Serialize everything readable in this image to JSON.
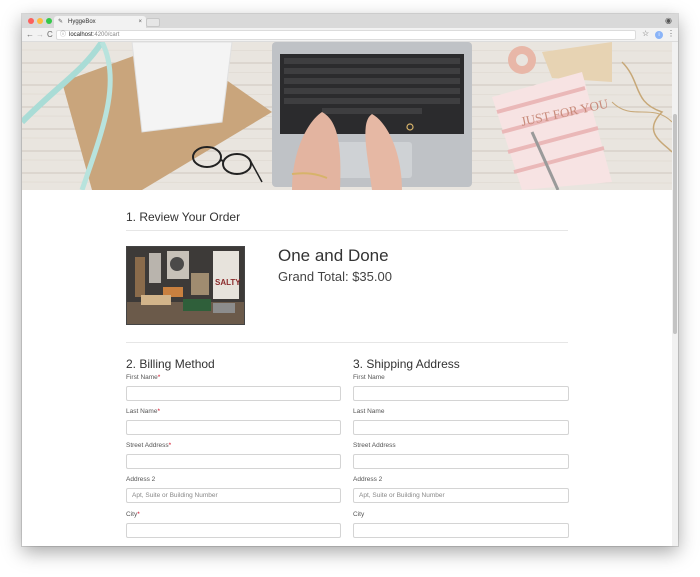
{
  "browser": {
    "tab_title": "HyggeBox",
    "tab_close": "×",
    "url_host": "localhost",
    "url_port_path": ":4200/cart",
    "back": "←",
    "forward": "→",
    "reload": "C",
    "info_icon": "ⓘ",
    "star": "☆",
    "ext": "i",
    "menu": "⋮",
    "profile": "◉"
  },
  "review": {
    "heading": "1. Review Your Order",
    "product_title": "One and Done",
    "grand_total": "Grand Total: $35.00",
    "product_image_text": "SALTY"
  },
  "billing": {
    "heading": "2. Billing Method",
    "fields": [
      {
        "label": "First Name",
        "required": "*",
        "placeholder": ""
      },
      {
        "label": "Last Name",
        "required": "*",
        "placeholder": ""
      },
      {
        "label": "Street Address",
        "required": "*",
        "placeholder": ""
      },
      {
        "label": "Address 2",
        "required": "",
        "placeholder": "Apt, Suite or Building Number"
      },
      {
        "label": "City",
        "required": "*",
        "placeholder": ""
      }
    ]
  },
  "shipping": {
    "heading": "3. Shipping Address",
    "fields": [
      {
        "label": "First Name",
        "placeholder": ""
      },
      {
        "label": "Last Name",
        "placeholder": ""
      },
      {
        "label": "Street Address",
        "placeholder": ""
      },
      {
        "label": "Address 2",
        "placeholder": "Apt, Suite or Building Number"
      },
      {
        "label": "City",
        "placeholder": ""
      }
    ]
  },
  "hero": {
    "card_text": "JUST FOR YOU"
  }
}
